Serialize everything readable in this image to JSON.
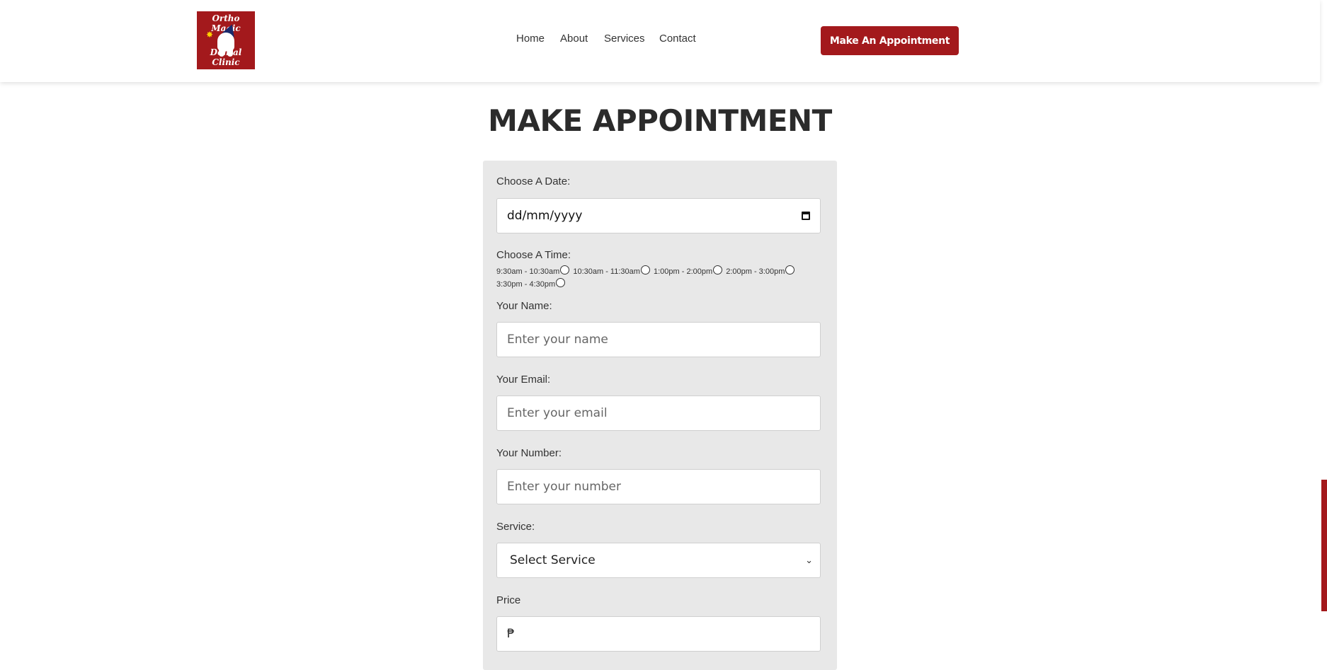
{
  "logo": {
    "line1": "Ortho Magic",
    "line2": "Dental Clinic"
  },
  "nav": {
    "home": "Home",
    "about": "About",
    "services": "Services",
    "contact": "Contact"
  },
  "cta": "Make An Appointment",
  "title": "MAKE APPOINTMENT",
  "form": {
    "date_label": "Choose A Date:",
    "date_value": "dd/mm/yyyy",
    "time_label": "Choose A Time:",
    "time_slots": [
      "9:30am - 10:30am",
      "10:30am - 11:30am",
      "1:00pm - 2:00pm",
      "2:00pm - 3:00pm",
      "3:30pm - 4:30pm"
    ],
    "name_label": "Your Name:",
    "name_placeholder": "Enter your name",
    "email_label": "Your Email:",
    "email_placeholder": "Enter your email",
    "number_label": "Your Number:",
    "number_placeholder": "Enter your number",
    "service_label": "Service:",
    "service_selected": "Select Service",
    "price_label": "Price",
    "price_prefix": "₱"
  },
  "colors": {
    "brand": "#a3191c",
    "form_bg": "#e8e8e8"
  }
}
